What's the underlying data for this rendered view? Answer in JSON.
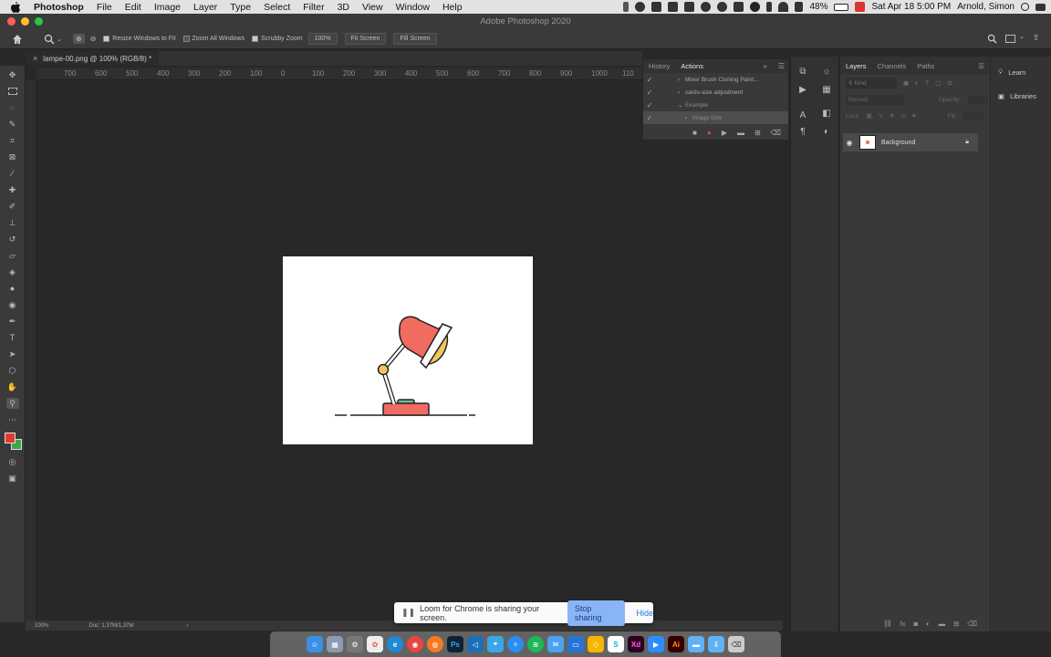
{
  "menubar": {
    "app_name": "Photoshop",
    "items": [
      "File",
      "Edit",
      "Image",
      "Layer",
      "Type",
      "Select",
      "Filter",
      "3D",
      "View",
      "Window",
      "Help"
    ],
    "battery": "48%",
    "datetime": "Sat Apr 18  5:00 PM",
    "user": "Arnold, Simon"
  },
  "window": {
    "title": "Adobe Photoshop 2020"
  },
  "options_bar": {
    "zoom_pct": "100%",
    "resize_windows": "Resize Windows to Fit",
    "zoom_all": "Zoom All Windows",
    "scrubby_zoom": "Scrubby Zoom",
    "fit_screen": "Fit Screen",
    "fill_screen": "Fill Screen"
  },
  "document": {
    "tab_label": "lampe-00.png @ 100% (RGB/8) *",
    "zoom": "100%",
    "doc_size": "Doc: 1,37M/1,37M"
  },
  "ruler_ticks": [
    "700",
    "600",
    "500",
    "400",
    "300",
    "200",
    "100",
    "0",
    "100",
    "200",
    "300",
    "400",
    "500",
    "600",
    "700",
    "800",
    "900",
    "1000",
    "110"
  ],
  "actions_panel": {
    "tabs": [
      "History",
      "Actions"
    ],
    "rows": [
      {
        "label": "Mixer Brush Cloning Paint..."
      },
      {
        "label": "cards-size adjustment"
      },
      {
        "label": "Example"
      },
      {
        "label": "Image Size"
      }
    ]
  },
  "layers_panel": {
    "tabs": [
      "Layers",
      "Channels",
      "Paths"
    ],
    "kind_placeholder": "Kind",
    "blend_mode": "Normal",
    "opacity_label": "Opacity:",
    "lock_label": "Lock:",
    "fill_label": "Fill:",
    "layer_name": "Background"
  },
  "learn_panel": {
    "learn": "Learn",
    "libraries": "Libraries"
  },
  "share_bar": {
    "message": "Loom for Chrome is sharing your screen.",
    "stop": "Stop sharing",
    "hide": "Hide"
  },
  "colors": {
    "lamp_red": "#f06b60",
    "lamp_yellow": "#f2c55c",
    "lamp_green": "#6cbf9f",
    "fg_color": "#e23c2f",
    "bg_color": "#39a845"
  },
  "dock_icons": [
    "finder",
    "launchpad",
    "system-prefs",
    "photos",
    "edge",
    "chrome",
    "firefox",
    "photoshop",
    "vscode",
    "maps",
    "safari",
    "spotify",
    "mail",
    "keynote",
    "sketch",
    "xd",
    "zoom",
    "illustrator",
    "folder",
    "downloads",
    "trash"
  ]
}
